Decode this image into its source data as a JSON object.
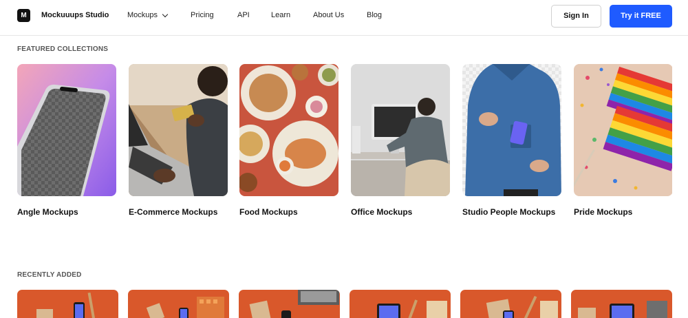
{
  "header": {
    "brand": "Mockuuups Studio",
    "logo_letter": "M",
    "nav": {
      "mockups": "Mockups",
      "pricing": "Pricing",
      "api": "API",
      "learn": "Learn",
      "about": "About Us",
      "blog": "Blog"
    },
    "sign_in": "Sign In",
    "try_free": "Try it FREE"
  },
  "featured": {
    "title": "FEATURED COLLECTIONS",
    "items": [
      {
        "label": "Angle Mockups"
      },
      {
        "label": "E-Commerce Mockups"
      },
      {
        "label": "Food Mockups"
      },
      {
        "label": "Office Mockups"
      },
      {
        "label": "Studio People Mockups"
      },
      {
        "label": "Pride Mockups"
      }
    ]
  },
  "recent": {
    "title": "RECENTLY ADDED"
  },
  "colors": {
    "accent": "#1f5bff",
    "recent_bg": "#d9582b"
  },
  "icons": {
    "logo": "brand-logo-icon",
    "dropdown": "chevron-down-icon"
  }
}
